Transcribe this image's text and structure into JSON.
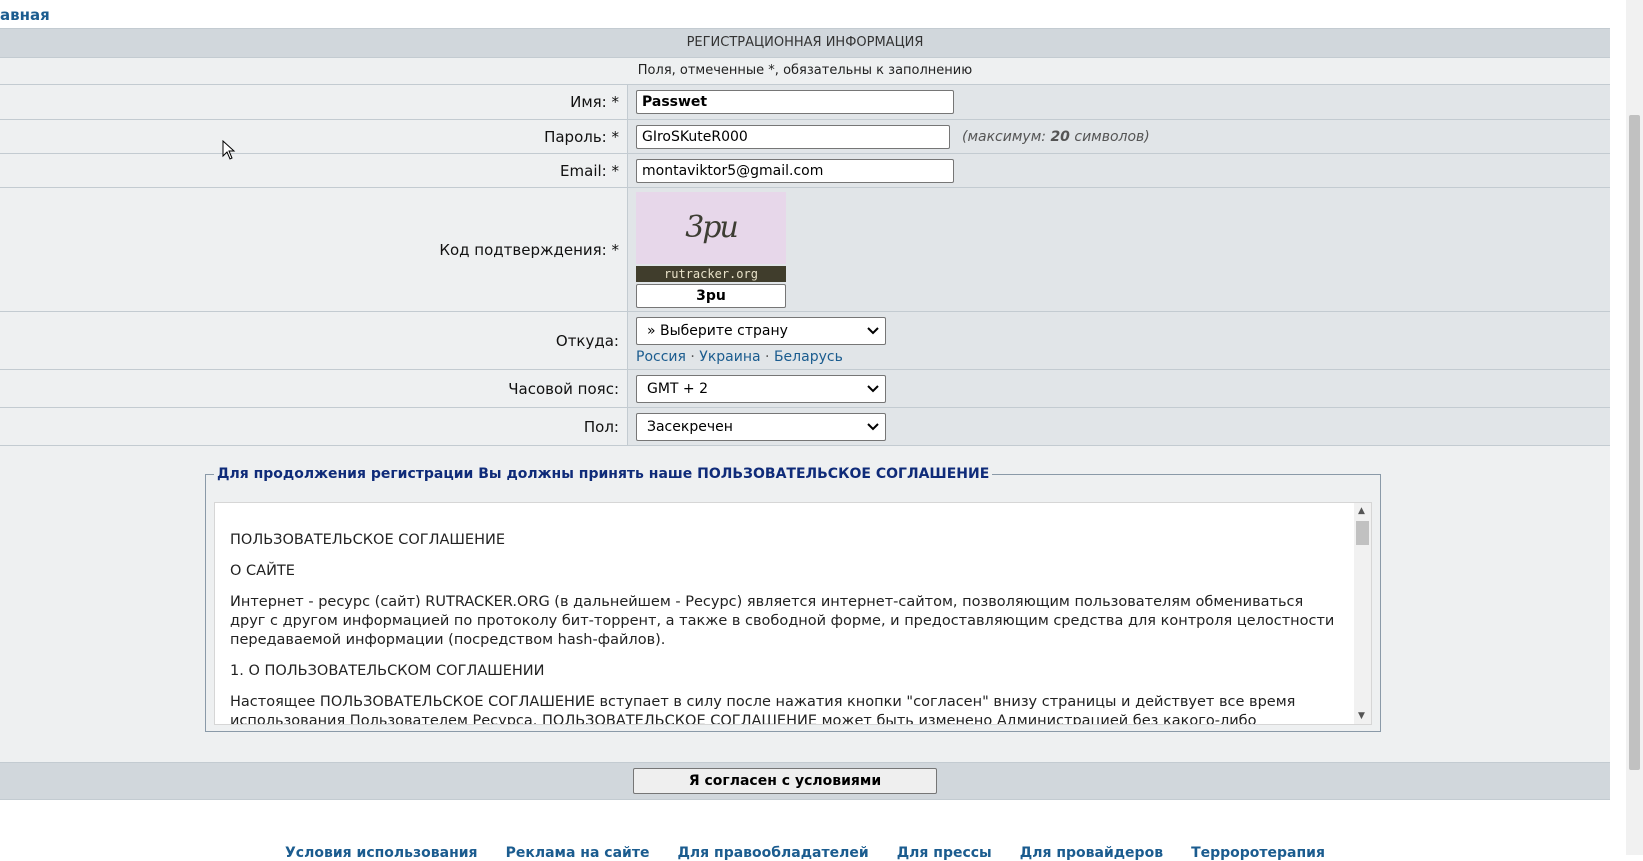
{
  "breadcrumb": "авная",
  "form": {
    "header": "РЕГИСТРАЦИОННАЯ ИНФОРМАЦИЯ",
    "note": "Поля, отмеченные *, обязательны к заполнению",
    "name": {
      "label": "Имя: *",
      "value": "Passwet"
    },
    "password": {
      "label": "Пароль: *",
      "value": "GIroSKuteR000",
      "hint_prefix": "(максимум: ",
      "hint_num": "20",
      "hint_suffix": " символов)"
    },
    "email": {
      "label": "Email: *",
      "value": "montaviktor5@gmail.com"
    },
    "captcha": {
      "label": "Код подтверждения: *",
      "image_text": "3pu",
      "image_footer": "rutracker.org",
      "value": "3pu"
    },
    "from": {
      "label": "Откуда:",
      "selected": "» Выберите страну",
      "quick_links": [
        "Россия",
        "Украина",
        "Беларусь"
      ],
      "sep": "·"
    },
    "timezone": {
      "label": "Часовой пояс:",
      "selected": "GMT + 2"
    },
    "gender": {
      "label": "Пол:",
      "selected": "Засекречен"
    }
  },
  "agreement": {
    "legend": "Для продолжения регистрации Вы должны принять наше ПОЛЬЗОВАТЕЛЬСКОЕ СОГЛАШЕНИЕ",
    "p1": "ПОЛЬЗОВАТЕЛЬСКОЕ СОГЛАШЕНИЕ",
    "p2": "О САЙТЕ",
    "p3": "Интернет - ресурс (сайт) RUTRACKER.ORG (в дальнейшем - Ресурс) является интернет-сайтом, позволяющим пользователям обмениваться друг с другом информацией по протоколу бит-торрент, а также в свободной форме, и предоставляющим средства для контроля целостности передаваемой информации (посредством hash-файлов).",
    "p4": "1. О ПОЛЬЗОВАТЕЛЬСКОМ СОГЛАШЕНИИ",
    "p5": "Настоящее ПОЛЬЗОВАТЕЛЬСКОЕ СОГЛАШЕНИЕ вступает в силу после нажатия кнопки \"согласен\" внизу страницы и действует все время использования Пользователем Ресурса. ПОЛЬЗОВАТЕЛЬСКОЕ СОГЛАШЕНИЕ может быть изменено Администрацией без какого-либо уведомления пользователей. Новая версия ПС вступает в силу по истечении 3 (трех) дней с момента ее размещения, если иное не",
    "agree_button": "Я согласен с условиями"
  },
  "footer": {
    "links": [
      "Условия использования",
      "Реклама на сайте",
      "Для правообладателей",
      "Для прессы",
      "Для провайдеров",
      "Терроротерапия"
    ]
  }
}
